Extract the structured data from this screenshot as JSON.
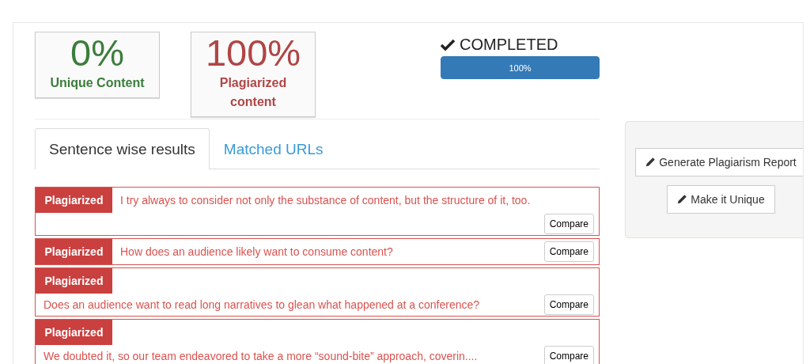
{
  "stats": [
    {
      "kind": "unique",
      "value": "0%",
      "label": "Unique Content"
    },
    {
      "kind": "plagiarized",
      "value": "100%",
      "label": "Plagiarized content"
    }
  ],
  "progress": {
    "status": "COMPLETED",
    "level": 1,
    "reading": "100%"
  },
  "tabs": [
    {
      "label": "Sentence wise results",
      "selected": true
    },
    {
      "label": "Matched URLs",
      "selected": false
    }
  ],
  "results": [
    {
      "kind": "inline-below",
      "badge": "Plagiarized",
      "sentence": "I try always to consider not only the substance of content, but the structure of it, too.",
      "button": "Compare"
    },
    {
      "kind": "inline",
      "badge": "Plagiarized",
      "sentence": "How does an audience likely want to consume content?",
      "button": "Compare"
    },
    {
      "kind": "stacked",
      "badge": "Plagiarized",
      "sentence": "Does an audience want to read long narratives to glean what happened at a conference?",
      "button": "Compare"
    },
    {
      "kind": "stacked",
      "badge": "Plagiarized",
      "sentence": "We doubted it, so our team endeavored to take a more “sound-bite” approach, coverin....",
      "button": "Compare"
    }
  ],
  "actions": [
    "Generate Plagiarism Report",
    "Make it Unique"
  ]
}
